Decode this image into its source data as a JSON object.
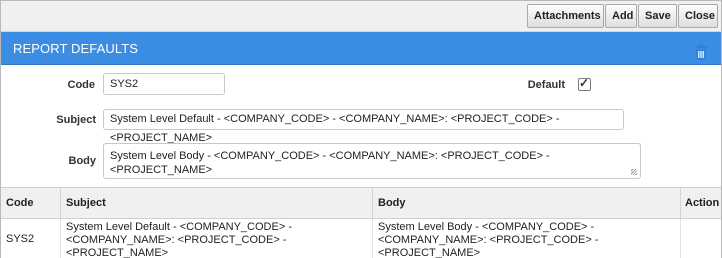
{
  "toolbar": {
    "attachments_label": "Attachments",
    "add_label": "Add",
    "save_label": "Save",
    "close_label": "Close"
  },
  "panel": {
    "title": "REPORT DEFAULTS"
  },
  "form": {
    "code_label": "Code",
    "code_value": "SYS2",
    "default_label": "Default",
    "default_checked": true,
    "default_tick": "✓",
    "subject_label": "Subject",
    "subject_value": "System Level Default - <COMPANY_CODE> - <COMPANY_NAME>: <PROJECT_CODE> - <PROJECT_NAME>",
    "body_label": "Body",
    "body_value": "System Level Body - <COMPANY_CODE> - <COMPANY_NAME>: <PROJECT_CODE> - <PROJECT_NAME>"
  },
  "grid": {
    "columns": [
      "Code",
      "Subject",
      "Body",
      "Action"
    ],
    "rows": [
      {
        "code": "SYS2",
        "subject": "System Level Default - <COMPANY_CODE> - <COMPANY_NAME>: <PROJECT_CODE> - <PROJECT_NAME>",
        "body": "System Level Body - <COMPANY_CODE> - <COMPANY_NAME>: <PROJECT_CODE> - <PROJECT_NAME>",
        "action_icon": "trash-icon"
      }
    ]
  },
  "colors": {
    "title_bar": "#3b8de3",
    "action_icon": "#2f80d6"
  }
}
